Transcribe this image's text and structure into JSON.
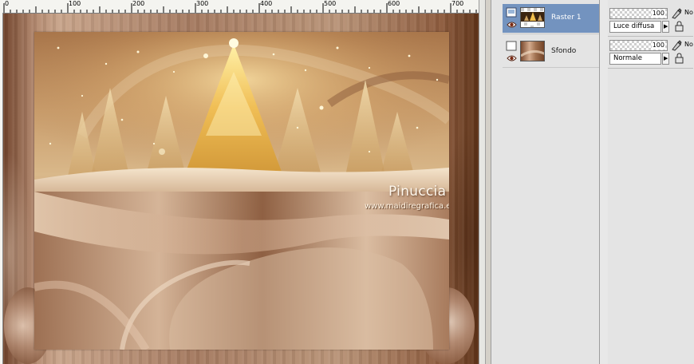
{
  "ruler": {
    "labels": [
      "0",
      "100",
      "200",
      "300",
      "400",
      "500",
      "600",
      "700"
    ]
  },
  "watermark": {
    "name": "Pinuccia",
    "url": "www.maidiregrafica.eu"
  },
  "layers": [
    {
      "name": "Raster 1",
      "selected": true,
      "opacity": "100",
      "blend_mode": "Luce diffusa",
      "column_truncated": "No"
    },
    {
      "name": "Sfondo",
      "selected": false,
      "opacity": "100",
      "blend_mode": "Normale",
      "column_truncated": "No"
    }
  ],
  "icons": {
    "layer_visibility": "eye-icon",
    "layer_type": "raster-layer-icon",
    "edit": "brush-icon",
    "lock": "lock-icon",
    "collapse": "arrow-right-icon"
  },
  "colors": {
    "selection": "#7393bf",
    "palette_bg": "#e2e2e2",
    "artwork_tone": "#c99d6c"
  }
}
